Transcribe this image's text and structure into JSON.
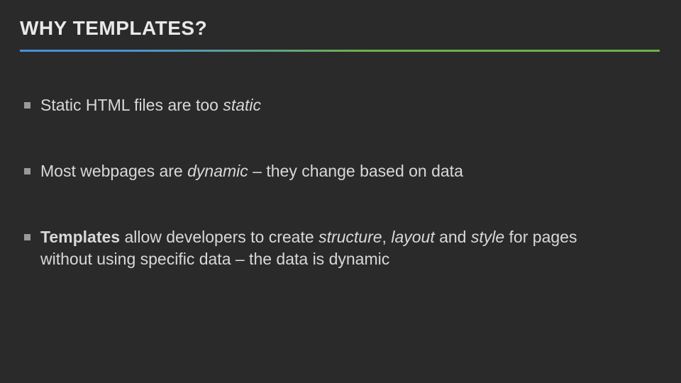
{
  "slide": {
    "title": "WHY TEMPLATES?",
    "bullets": [
      {
        "html": "Static HTML files are too <em>static</em>"
      },
      {
        "html": "Most webpages are <em>dynamic</em> – they change based on data"
      },
      {
        "html": "<strong>Templates</strong> allow developers to create <em>structure</em>, <em>layout</em> and <em>style</em> for pages without using specific data – the data is dynamic"
      }
    ]
  },
  "colors": {
    "background": "#2a2a2a",
    "text": "#d8d8d8",
    "dividerLeft": "#4a90d9",
    "dividerRight": "#6fb04a"
  }
}
